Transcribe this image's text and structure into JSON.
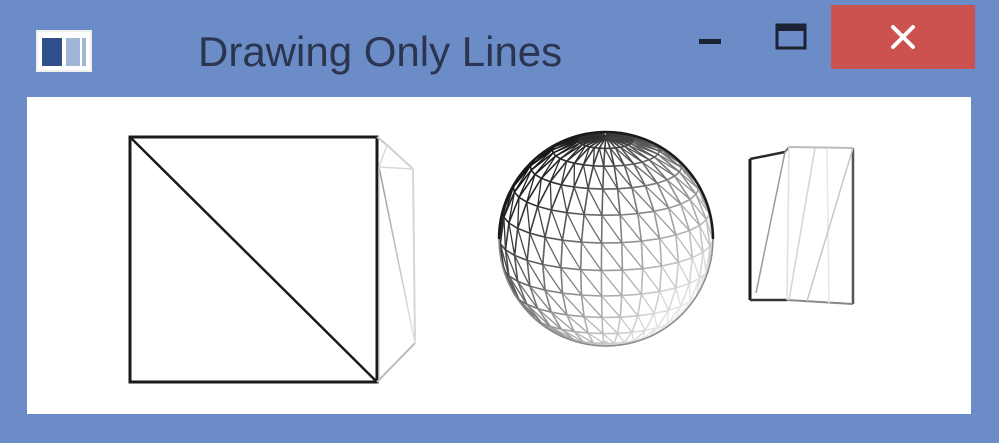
{
  "window": {
    "title": "Drawing Only Lines",
    "title_bar_color": "#6b8cc6",
    "close_button_color": "#cc5250",
    "app_icon": "window-app-icon",
    "buttons": {
      "minimize_icon": "minimize-icon",
      "maximize_icon": "maximize-icon",
      "close_icon": "close-icon"
    }
  },
  "scene": {
    "render_mode": "wireframe",
    "shapes": [
      {
        "type": "box",
        "icon": "wireframe-box"
      },
      {
        "type": "sphere",
        "icon": "wireframe-sphere"
      },
      {
        "type": "cylinder",
        "icon": "wireframe-cylinder"
      }
    ]
  }
}
